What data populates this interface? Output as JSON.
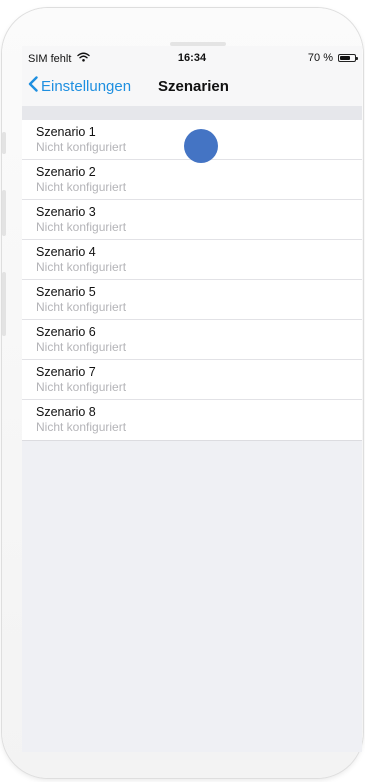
{
  "status_bar": {
    "carrier": "SIM fehlt",
    "time": "16:34",
    "battery_label": "70 %",
    "battery_level": 0.7,
    "icons": [
      "wifi-icon",
      "battery-icon"
    ]
  },
  "nav": {
    "back_label": "Einstellungen",
    "title": "Szenarien",
    "accent_color": "#1e8fe0"
  },
  "scenarios": [
    {
      "title": "Szenario 1",
      "subtitle": "Nicht konfiguriert"
    },
    {
      "title": "Szenario 2",
      "subtitle": "Nicht konfiguriert"
    },
    {
      "title": "Szenario 3",
      "subtitle": "Nicht konfiguriert"
    },
    {
      "title": "Szenario 4",
      "subtitle": "Nicht konfiguriert"
    },
    {
      "title": "Szenario 5",
      "subtitle": "Nicht konfiguriert"
    },
    {
      "title": "Szenario 6",
      "subtitle": "Nicht konfiguriert"
    },
    {
      "title": "Szenario 7",
      "subtitle": "Nicht konfiguriert"
    },
    {
      "title": "Szenario 8",
      "subtitle": "Nicht konfiguriert"
    }
  ]
}
